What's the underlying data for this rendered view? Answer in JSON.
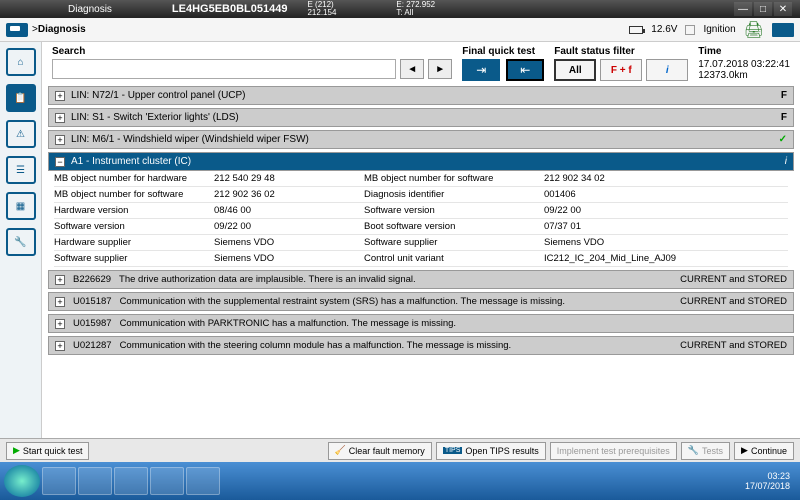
{
  "title": "Diagnosis",
  "vin": "LE4HG5EB0BL051449",
  "ecodes": {
    "l1": "E (212)",
    "l2": "212.154",
    "r1": "E: 272.952",
    "r2": "T: All"
  },
  "crumb": {
    "path": "Diagnosis",
    "voltage": "12.6V",
    "ignition": "Ignition"
  },
  "search": {
    "label": "Search",
    "value": ""
  },
  "quicktest": {
    "label": "Final quick test"
  },
  "filter": {
    "label": "Fault status filter",
    "all": "All",
    "ff": "F + f",
    "i": "i"
  },
  "time": {
    "label": "Time",
    "stamp": "17.07.2018 03:22:41",
    "km": "12373.0km"
  },
  "groups": [
    {
      "txt": "LIN: N72/1 - Upper control panel (UCP)",
      "st": "F"
    },
    {
      "txt": "LIN: S1 - Switch 'Exterior lights' (LDS)",
      "st": "F"
    },
    {
      "txt": "LIN: M6/1 - Windshield wiper (Windshield wiper FSW)",
      "st": "✓"
    },
    {
      "txt": "A1 - Instrument cluster (IC)",
      "st": "i",
      "blue": true,
      "open": true
    }
  ],
  "details": [
    {
      "k1": "MB object number for hardware",
      "v1": "212 540 29 48",
      "k2": "MB object number for software",
      "v2": "212 902 34 02"
    },
    {
      "k1": "MB object number for software",
      "v1": "212 902 36 02",
      "k2": "Diagnosis identifier",
      "v2": "001406"
    },
    {
      "k1": "Hardware version",
      "v1": "08/46 00",
      "k2": "Software version",
      "v2": "09/22 00"
    },
    {
      "k1": "Software version",
      "v1": "09/22 00",
      "k2": "Boot software version",
      "v2": "07/37 01"
    },
    {
      "k1": "Hardware supplier",
      "v1": "Siemens VDO",
      "k2": "Software supplier",
      "v2": "Siemens VDO"
    },
    {
      "k1": "Software supplier",
      "v1": "Siemens VDO",
      "k2": "Control unit variant",
      "v2": "IC212_IC_204_Mid_Line_AJ09"
    }
  ],
  "faults": [
    {
      "code": "B226629",
      "desc": "The drive authorization data are implausible. There is an invalid signal.",
      "st": "CURRENT and STORED"
    },
    {
      "code": "U015187",
      "desc": "Communication with the supplemental restraint system (SRS) has a malfunction. The message is missing.",
      "st": "CURRENT and STORED"
    },
    {
      "code": "U015987",
      "desc": "Communication with PARKTRONIC has a malfunction. The message is missing.",
      "st": ""
    },
    {
      "code": "U021287",
      "desc": "Communication with the steering column module has a malfunction. The message is missing.",
      "st": "CURRENT and STORED"
    }
  ],
  "bottom": {
    "start": "Start quick test",
    "clear": "Clear fault memory",
    "tips": "Open TIPS results",
    "impl": "Implement test prerequisites",
    "tests": "Tests",
    "cont": "Continue"
  },
  "clock": {
    "t": "03:23",
    "d": "17/07/2018"
  }
}
